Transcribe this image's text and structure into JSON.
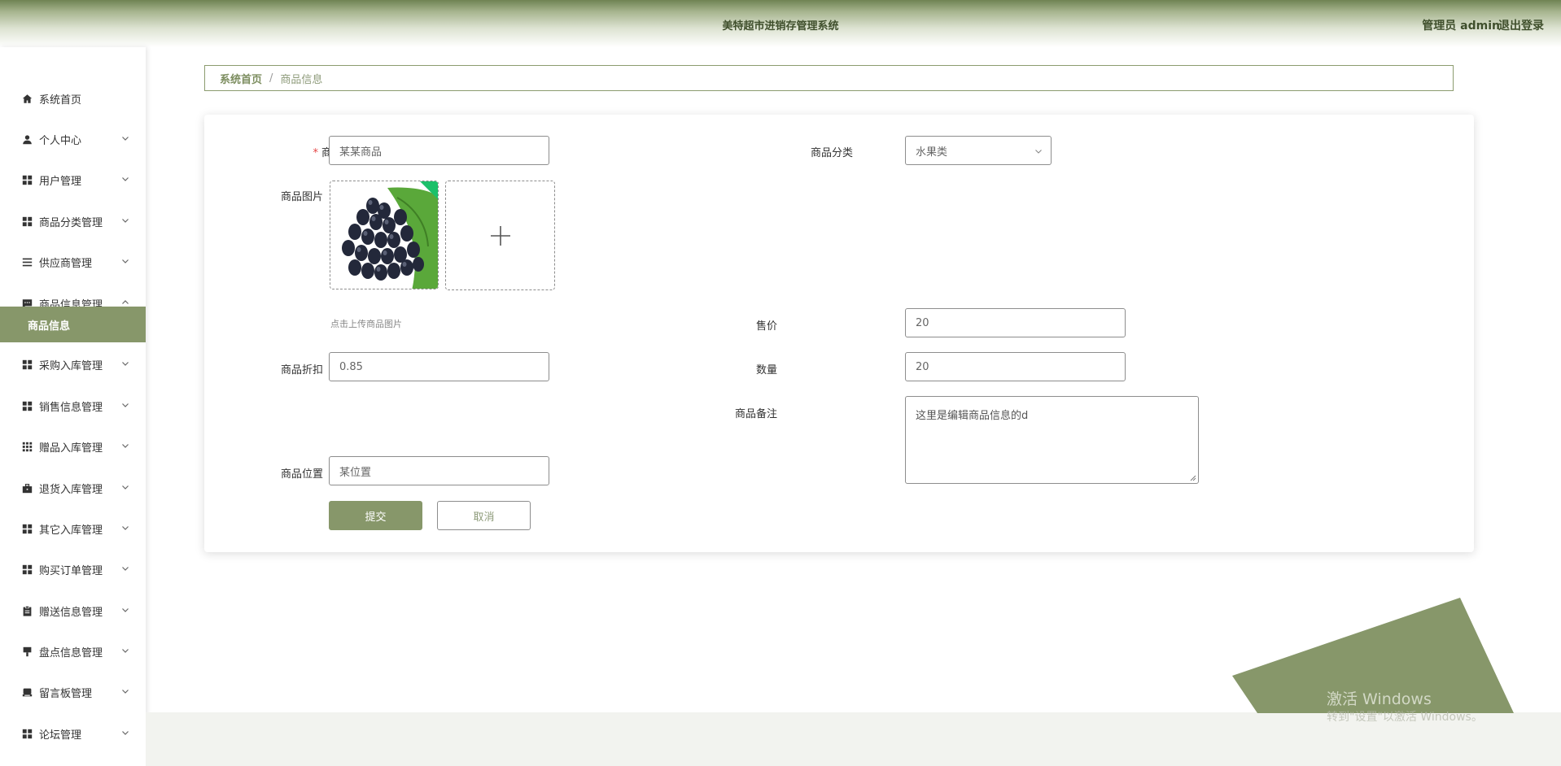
{
  "header": {
    "title": "美特超市进销存管理系统",
    "user": "管理员 admin",
    "logout": "退出登录"
  },
  "sidebar": {
    "items": [
      {
        "label": "系统首页",
        "icon": "home-icon"
      },
      {
        "label": "个人中心",
        "icon": "user-icon"
      },
      {
        "label": "用户管理",
        "icon": "grid-icon"
      },
      {
        "label": "商品分类管理",
        "icon": "grid-icon"
      },
      {
        "label": "供应商管理",
        "icon": "list-icon"
      },
      {
        "label": "商品信息管理",
        "icon": "chat-icon"
      },
      {
        "label": "商品信息",
        "icon": ""
      },
      {
        "label": "采购入库管理",
        "icon": "grid-icon"
      },
      {
        "label": "销售信息管理",
        "icon": "grid-icon"
      },
      {
        "label": "赠品入库管理",
        "icon": "apps-icon"
      },
      {
        "label": "退货入库管理",
        "icon": "briefcase-icon"
      },
      {
        "label": "其它入库管理",
        "icon": "grid-icon"
      },
      {
        "label": "购买订单管理",
        "icon": "grid-icon"
      },
      {
        "label": "赠送信息管理",
        "icon": "clipboard-icon"
      },
      {
        "label": "盘点信息管理",
        "icon": "stamp-icon"
      },
      {
        "label": "留言板管理",
        "icon": "inbox-icon"
      },
      {
        "label": "论坛管理",
        "icon": "grid-icon"
      }
    ]
  },
  "breadcrumb": {
    "home": "系统首页",
    "separator": "/",
    "current": "商品信息"
  },
  "form": {
    "name_label": "商品名称",
    "name_required": "*",
    "name_value": "某某商品",
    "category_label": "商品分类",
    "category_value": "水果类",
    "image_label": "商品图片",
    "image_hint": "点击上传商品图片",
    "price_label": "售价",
    "price_value": "20",
    "discount_label": "商品折扣",
    "discount_value": "0.85",
    "quantity_label": "数量",
    "quantity_value": "20",
    "remark_label": "商品备注",
    "remark_value": "这里是编辑商品信息的d",
    "location_label": "商品位置",
    "location_value": "某位置",
    "submit": "提交",
    "cancel": "取消"
  },
  "watermark": {
    "line1": "激活 Windows",
    "line2": "转到\"设置\"以激活 Windows。"
  },
  "colors": {
    "accent": "#87976a",
    "header_dark": "#6f8353",
    "required": "#e54545"
  }
}
